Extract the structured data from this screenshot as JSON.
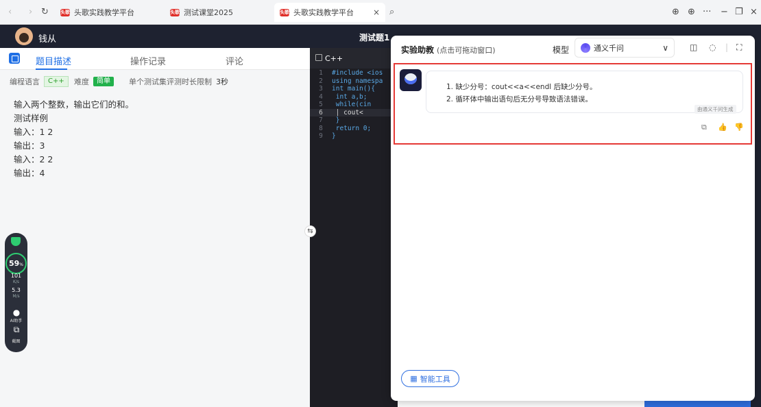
{
  "browser": {
    "tabs": [
      {
        "label": "头歌实践教学平台",
        "favicon": "头歌"
      },
      {
        "label": "测试课堂2025",
        "favicon": "头歌"
      },
      {
        "label": "头歌实践教学平台",
        "favicon": "头歌",
        "active": true
      }
    ],
    "close_glyph": "×",
    "search_glyph": "⌕",
    "nav_glyphs": {
      "back": "‹",
      "forward": "›",
      "reload": "↻"
    },
    "window_glyphs": {
      "download": "⊕",
      "globe": "⊕",
      "more": "···",
      "minimize": "−",
      "restore": "❐",
      "close": "×"
    }
  },
  "header": {
    "username": "钱从",
    "question_title": "测试题1"
  },
  "problem": {
    "tabs": [
      "题目描述",
      "操作记录",
      "评论"
    ],
    "lang_label": "编程语言",
    "lang_value": "C++",
    "difficulty_label": "难度",
    "difficulty_value": "简单",
    "time_limit": "单个测试集评测时长限制",
    "time_value": "3秒",
    "lines": [
      "输入两个整数，输出它们的和。",
      "测试样例",
      "输入：1 2",
      "输出：3",
      "输入：2 2",
      "输出：4"
    ]
  },
  "widget": {
    "percent": "59",
    "percent_unit": "%",
    "up_value": "101",
    "up_unit": "K/s",
    "down_value": "5.3",
    "down_unit": "M/s",
    "ai_label": "AI助手",
    "screenshot_label": "截图"
  },
  "editor": {
    "tab_label": "C++",
    "lines": [
      {
        "n": "1",
        "code": "#include <ios"
      },
      {
        "n": "2",
        "code": "using namespa"
      },
      {
        "n": "3",
        "code": "int main(){"
      },
      {
        "n": "4",
        "code": "    int a,b;"
      },
      {
        "n": "5",
        "code": "    while(cin"
      },
      {
        "n": "6",
        "code": "    │   cout<"
      },
      {
        "n": "7",
        "code": "    }"
      },
      {
        "n": "8",
        "code": "    return 0;"
      },
      {
        "n": "9",
        "code": "}"
      }
    ]
  },
  "assistant": {
    "title": "实验助教",
    "subtitle": "(点击可拖动窗口)",
    "model_label": "模型",
    "model_value": "通义千问",
    "chevron": "∨",
    "messages": [
      "1. 缺少分号：cout<<a<<endl 后缺少分号。",
      "2. 循环体中输出语句后无分号导致语法错误。"
    ],
    "generated_by": "由通义千问生成",
    "tools_label": "智能工具"
  },
  "colors": {
    "accent": "#1f6fe5",
    "highlight": "#e53935",
    "dark_header": "#1e2230",
    "success": "#22b14c"
  }
}
